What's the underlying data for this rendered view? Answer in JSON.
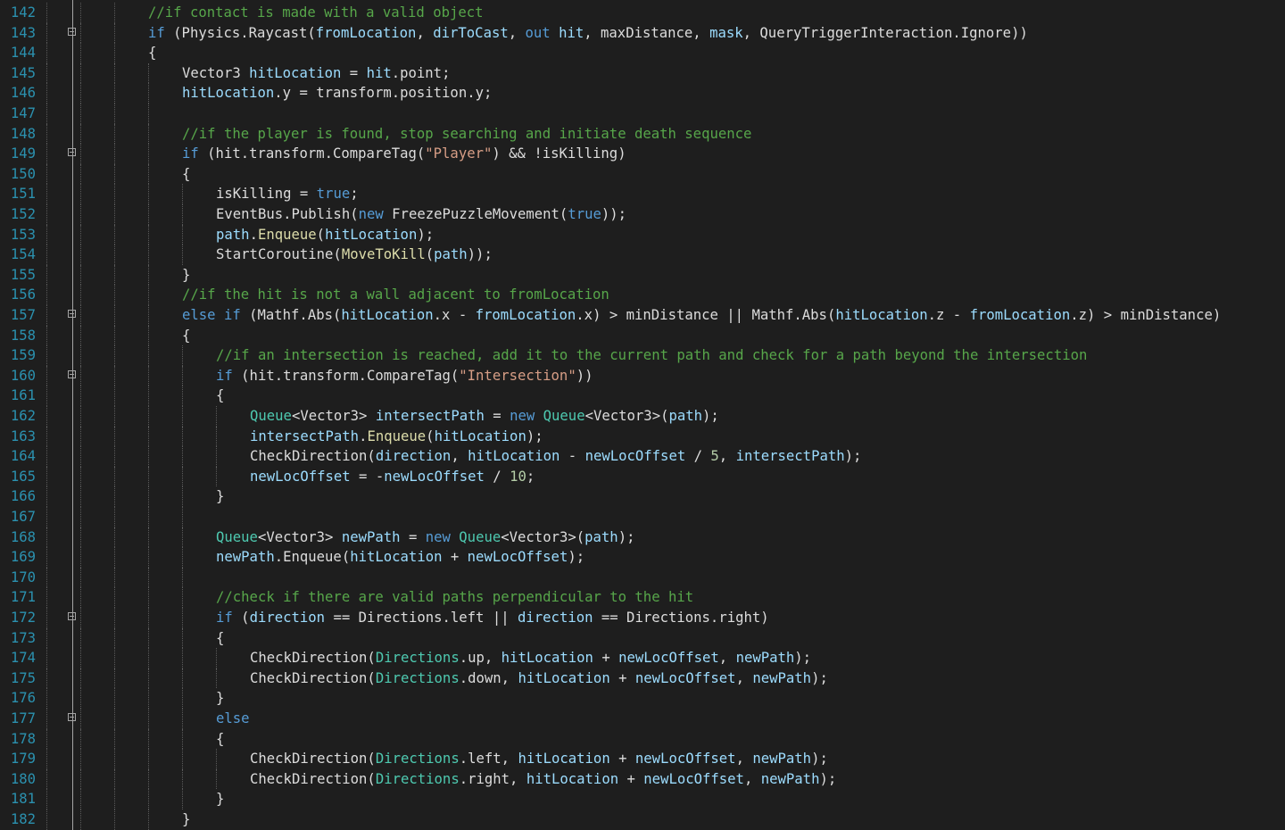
{
  "editor": {
    "theme_colors": {
      "background": "#1e1e1e",
      "line_number": "#2b91af",
      "comment": "#57a64a",
      "keyword": "#569cd6",
      "string": "#d69d85",
      "type": "#4ec9b0",
      "field": "#9cdcfe",
      "method": "#dcdcaa",
      "number": "#b5cea8",
      "plain": "#dcdcdc"
    },
    "lines": [
      {
        "n": "142",
        "indent": 4,
        "fold": false,
        "tokens": [
          [
            "comment",
            "//if contact is made with a valid object"
          ]
        ]
      },
      {
        "n": "143",
        "indent": 4,
        "fold": true,
        "tokens": [
          [
            "kw",
            "if"
          ],
          [
            "p",
            " (Physics.Raycast("
          ],
          [
            "fld",
            "fromLocation"
          ],
          [
            "p",
            ", "
          ],
          [
            "fld",
            "dirToCast"
          ],
          [
            "p",
            ", "
          ],
          [
            "kw",
            "out"
          ],
          [
            "p",
            " "
          ],
          [
            "fld",
            "hit"
          ],
          [
            "p",
            ", maxDistance, "
          ],
          [
            "fld",
            "mask"
          ],
          [
            "p",
            ", QueryTriggerInteraction.Ignore))"
          ]
        ]
      },
      {
        "n": "144",
        "indent": 4,
        "fold": false,
        "tokens": [
          [
            "p",
            "{"
          ]
        ]
      },
      {
        "n": "145",
        "indent": 5,
        "fold": false,
        "tokens": [
          [
            "p",
            "Vector3 "
          ],
          [
            "fld",
            "hitLocation"
          ],
          [
            "p",
            " = "
          ],
          [
            "fld",
            "hit"
          ],
          [
            "p",
            ".point;"
          ]
        ]
      },
      {
        "n": "146",
        "indent": 5,
        "fold": false,
        "tokens": [
          [
            "fld",
            "hitLocation"
          ],
          [
            "p",
            ".y = transform.position.y;"
          ]
        ]
      },
      {
        "n": "147",
        "indent": 5,
        "fold": false,
        "tokens": []
      },
      {
        "n": "148",
        "indent": 5,
        "fold": false,
        "tokens": [
          [
            "comment",
            "//if the player is found, stop searching and initiate death sequence"
          ]
        ]
      },
      {
        "n": "149",
        "indent": 5,
        "fold": true,
        "tokens": [
          [
            "kw",
            "if"
          ],
          [
            "p",
            " (hit.transform.CompareTag("
          ],
          [
            "str",
            "\"Player\""
          ],
          [
            "p",
            ") && !isKilling)"
          ]
        ]
      },
      {
        "n": "150",
        "indent": 5,
        "fold": false,
        "tokens": [
          [
            "p",
            "{"
          ]
        ]
      },
      {
        "n": "151",
        "indent": 6,
        "fold": false,
        "tokens": [
          [
            "p",
            "isKilling = "
          ],
          [
            "kw",
            "true"
          ],
          [
            "p",
            ";"
          ]
        ]
      },
      {
        "n": "152",
        "indent": 6,
        "fold": false,
        "tokens": [
          [
            "p",
            "EventBus.Publish("
          ],
          [
            "kw",
            "new"
          ],
          [
            "p",
            " FreezePuzzleMovement("
          ],
          [
            "kw",
            "true"
          ],
          [
            "p",
            "));"
          ]
        ]
      },
      {
        "n": "153",
        "indent": 6,
        "fold": false,
        "tokens": [
          [
            "fld",
            "path"
          ],
          [
            "p",
            "."
          ],
          [
            "meth",
            "Enqueue"
          ],
          [
            "p",
            "("
          ],
          [
            "fld",
            "hitLocation"
          ],
          [
            "p",
            ");"
          ]
        ]
      },
      {
        "n": "154",
        "indent": 6,
        "fold": false,
        "tokens": [
          [
            "p",
            "StartCoroutine("
          ],
          [
            "meth",
            "MoveToKill"
          ],
          [
            "p",
            "("
          ],
          [
            "fld",
            "path"
          ],
          [
            "p",
            "));"
          ]
        ]
      },
      {
        "n": "155",
        "indent": 5,
        "fold": false,
        "tokens": [
          [
            "p",
            "}"
          ]
        ]
      },
      {
        "n": "156",
        "indent": 5,
        "fold": false,
        "tokens": [
          [
            "comment",
            "//if the hit is not a wall adjacent to fromLocation"
          ]
        ]
      },
      {
        "n": "157",
        "indent": 5,
        "fold": true,
        "tokens": [
          [
            "kw",
            "else if"
          ],
          [
            "p",
            " (Mathf.Abs("
          ],
          [
            "fld",
            "hitLocation"
          ],
          [
            "p",
            ".x - "
          ],
          [
            "fld",
            "fromLocation"
          ],
          [
            "p",
            ".x) > minDistance || Mathf.Abs("
          ],
          [
            "fld",
            "hitLocation"
          ],
          [
            "p",
            ".z - "
          ],
          [
            "fld",
            "fromLocation"
          ],
          [
            "p",
            ".z) > minDistance)"
          ]
        ]
      },
      {
        "n": "158",
        "indent": 5,
        "fold": false,
        "tokens": [
          [
            "p",
            "{"
          ]
        ]
      },
      {
        "n": "159",
        "indent": 6,
        "fold": false,
        "tokens": [
          [
            "comment",
            "//if an intersection is reached, add it to the current path and check for a path beyond the intersection"
          ]
        ]
      },
      {
        "n": "160",
        "indent": 6,
        "fold": true,
        "tokens": [
          [
            "kw",
            "if"
          ],
          [
            "p",
            " (hit.transform.CompareTag("
          ],
          [
            "str",
            "\"Intersection\""
          ],
          [
            "p",
            "))"
          ]
        ]
      },
      {
        "n": "161",
        "indent": 6,
        "fold": false,
        "tokens": [
          [
            "p",
            "{"
          ]
        ]
      },
      {
        "n": "162",
        "indent": 7,
        "fold": false,
        "tokens": [
          [
            "type",
            "Queue"
          ],
          [
            "p",
            "<Vector3> "
          ],
          [
            "fld",
            "intersectPath"
          ],
          [
            "p",
            " = "
          ],
          [
            "kw",
            "new"
          ],
          [
            "p",
            " "
          ],
          [
            "type",
            "Queue"
          ],
          [
            "p",
            "<Vector3>("
          ],
          [
            "fld",
            "path"
          ],
          [
            "p",
            ");"
          ]
        ]
      },
      {
        "n": "163",
        "indent": 7,
        "fold": false,
        "tokens": [
          [
            "fld",
            "intersectPath"
          ],
          [
            "p",
            "."
          ],
          [
            "meth",
            "Enqueue"
          ],
          [
            "p",
            "("
          ],
          [
            "fld",
            "hitLocation"
          ],
          [
            "p",
            ");"
          ]
        ]
      },
      {
        "n": "164",
        "indent": 7,
        "fold": false,
        "tokens": [
          [
            "p",
            "CheckDirection("
          ],
          [
            "fld",
            "direction"
          ],
          [
            "p",
            ", "
          ],
          [
            "fld",
            "hitLocation"
          ],
          [
            "p",
            " - "
          ],
          [
            "fld",
            "newLocOffset"
          ],
          [
            "p",
            " / "
          ],
          [
            "num",
            "5"
          ],
          [
            "p",
            ", "
          ],
          [
            "fld",
            "intersectPath"
          ],
          [
            "p",
            ");"
          ]
        ]
      },
      {
        "n": "165",
        "indent": 7,
        "fold": false,
        "tokens": [
          [
            "fld",
            "newLocOffset"
          ],
          [
            "p",
            " = -"
          ],
          [
            "fld",
            "newLocOffset"
          ],
          [
            "p",
            " / "
          ],
          [
            "num",
            "10"
          ],
          [
            "p",
            ";"
          ]
        ]
      },
      {
        "n": "166",
        "indent": 6,
        "fold": false,
        "tokens": [
          [
            "p",
            "}"
          ]
        ]
      },
      {
        "n": "167",
        "indent": 6,
        "fold": false,
        "tokens": []
      },
      {
        "n": "168",
        "indent": 6,
        "fold": false,
        "tokens": [
          [
            "type",
            "Queue"
          ],
          [
            "p",
            "<Vector3> "
          ],
          [
            "fld",
            "newPath"
          ],
          [
            "p",
            " = "
          ],
          [
            "kw",
            "new"
          ],
          [
            "p",
            " "
          ],
          [
            "type",
            "Queue"
          ],
          [
            "p",
            "<Vector3>("
          ],
          [
            "fld",
            "path"
          ],
          [
            "p",
            ");"
          ]
        ]
      },
      {
        "n": "169",
        "indent": 6,
        "fold": false,
        "tokens": [
          [
            "fld",
            "newPath"
          ],
          [
            "p",
            ".Enqueue("
          ],
          [
            "fld",
            "hitLocation"
          ],
          [
            "p",
            " + "
          ],
          [
            "fld",
            "newLocOffset"
          ],
          [
            "p",
            ");"
          ]
        ]
      },
      {
        "n": "170",
        "indent": 6,
        "fold": false,
        "tokens": []
      },
      {
        "n": "171",
        "indent": 6,
        "fold": false,
        "tokens": [
          [
            "comment",
            "//check if there are valid paths perpendicular to the hit"
          ]
        ]
      },
      {
        "n": "172",
        "indent": 6,
        "fold": true,
        "tokens": [
          [
            "kw",
            "if"
          ],
          [
            "p",
            " ("
          ],
          [
            "fld",
            "direction"
          ],
          [
            "p",
            " == Directions.left || "
          ],
          [
            "fld",
            "direction"
          ],
          [
            "p",
            " == Directions.right)"
          ]
        ]
      },
      {
        "n": "173",
        "indent": 6,
        "fold": false,
        "tokens": [
          [
            "p",
            "{"
          ]
        ]
      },
      {
        "n": "174",
        "indent": 7,
        "fold": false,
        "tokens": [
          [
            "p",
            "CheckDirection("
          ],
          [
            "type",
            "Directions"
          ],
          [
            "p",
            ".up, "
          ],
          [
            "fld",
            "hitLocation"
          ],
          [
            "p",
            " + "
          ],
          [
            "fld",
            "newLocOffset"
          ],
          [
            "p",
            ", "
          ],
          [
            "fld",
            "newPath"
          ],
          [
            "p",
            ");"
          ]
        ]
      },
      {
        "n": "175",
        "indent": 7,
        "fold": false,
        "tokens": [
          [
            "p",
            "CheckDirection("
          ],
          [
            "type",
            "Directions"
          ],
          [
            "p",
            ".down, "
          ],
          [
            "fld",
            "hitLocation"
          ],
          [
            "p",
            " + "
          ],
          [
            "fld",
            "newLocOffset"
          ],
          [
            "p",
            ", "
          ],
          [
            "fld",
            "newPath"
          ],
          [
            "p",
            ");"
          ]
        ]
      },
      {
        "n": "176",
        "indent": 6,
        "fold": false,
        "tokens": [
          [
            "p",
            "}"
          ]
        ]
      },
      {
        "n": "177",
        "indent": 6,
        "fold": true,
        "tokens": [
          [
            "kw",
            "else"
          ]
        ]
      },
      {
        "n": "178",
        "indent": 6,
        "fold": false,
        "tokens": [
          [
            "p",
            "{"
          ]
        ]
      },
      {
        "n": "179",
        "indent": 7,
        "fold": false,
        "tokens": [
          [
            "p",
            "CheckDirection("
          ],
          [
            "type",
            "Directions"
          ],
          [
            "p",
            ".left, "
          ],
          [
            "fld",
            "hitLocation"
          ],
          [
            "p",
            " + "
          ],
          [
            "fld",
            "newLocOffset"
          ],
          [
            "p",
            ", "
          ],
          [
            "fld",
            "newPath"
          ],
          [
            "p",
            ");"
          ]
        ]
      },
      {
        "n": "180",
        "indent": 7,
        "fold": false,
        "tokens": [
          [
            "p",
            "CheckDirection("
          ],
          [
            "type",
            "Directions"
          ],
          [
            "p",
            ".right, "
          ],
          [
            "fld",
            "hitLocation"
          ],
          [
            "p",
            " + "
          ],
          [
            "fld",
            "newLocOffset"
          ],
          [
            "p",
            ", "
          ],
          [
            "fld",
            "newPath"
          ],
          [
            "p",
            ");"
          ]
        ]
      },
      {
        "n": "181",
        "indent": 6,
        "fold": false,
        "tokens": [
          [
            "p",
            "}"
          ]
        ]
      },
      {
        "n": "182",
        "indent": 5,
        "fold": false,
        "tokens": [
          [
            "p",
            "}"
          ]
        ]
      }
    ]
  }
}
